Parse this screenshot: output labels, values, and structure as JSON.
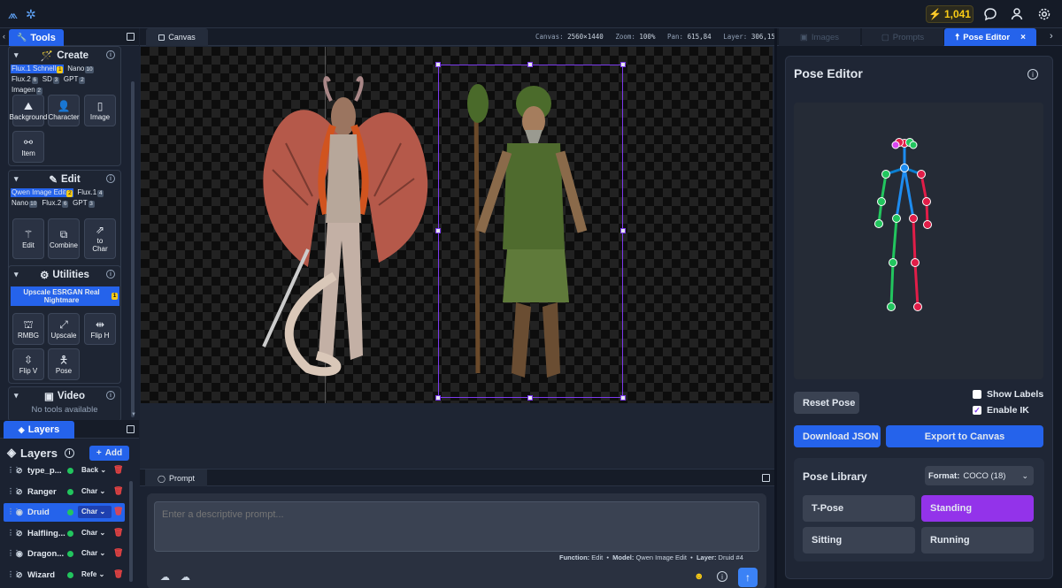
{
  "topbar": {
    "credits": "1,041"
  },
  "tools_panel": {
    "tab_label": "Tools",
    "create": {
      "title": "Create",
      "models": [
        {
          "name": "Flux.1 Schnell",
          "badge": "1",
          "selected": true,
          "yellow": true
        },
        {
          "name": "Nano",
          "badge": "10",
          "selected": false
        },
        {
          "name": "Flux.2",
          "badge": "6",
          "selected": false
        },
        {
          "name": "SD",
          "badge": "3",
          "selected": false
        },
        {
          "name": "GPT",
          "badge": "2",
          "selected": false
        },
        {
          "name": "Imagen",
          "badge": "2",
          "selected": false
        }
      ],
      "buttons": [
        "Background",
        "Character",
        "Image",
        "Item"
      ]
    },
    "edit": {
      "title": "Edit",
      "models": [
        {
          "name": "Qwen Image Edit",
          "badge": "2",
          "selected": true,
          "yellow": true
        },
        {
          "name": "Flux.1",
          "badge": "4",
          "selected": false
        },
        {
          "name": "Nano",
          "badge": "10",
          "selected": false
        },
        {
          "name": "Flux.2",
          "badge": "6",
          "selected": false
        },
        {
          "name": "GPT",
          "badge": "3",
          "selected": false
        }
      ],
      "buttons": [
        "Edit",
        "Combine",
        "to\nChar"
      ]
    },
    "utilities": {
      "title": "Utilities",
      "upscale_model": "Upscale ESRGAN Real Nightmare",
      "upscale_badge": "1",
      "buttons": [
        "RMBG",
        "Upscale",
        "Flip H",
        "Flip V",
        "Pose"
      ]
    },
    "video": {
      "title": "Video",
      "empty": "No tools available"
    }
  },
  "layers_panel": {
    "tab_label": "Layers",
    "title": "Layers",
    "add_label": "Add",
    "rows": [
      {
        "name": "type_p...",
        "type": "Back",
        "selected": false,
        "visible": false
      },
      {
        "name": "Ranger",
        "type": "Char",
        "selected": false,
        "visible": false
      },
      {
        "name": "Druid",
        "type": "Char",
        "selected": true,
        "visible": true
      },
      {
        "name": "Halfling...",
        "type": "Char",
        "selected": false,
        "visible": false
      },
      {
        "name": "Dragon...",
        "type": "Char",
        "selected": false,
        "visible": true
      },
      {
        "name": "Wizard",
        "type": "Refe",
        "selected": false,
        "visible": false
      }
    ]
  },
  "canvas_panel": {
    "tab_label": "Canvas",
    "status": {
      "canvas_label": "Canvas:",
      "canvas_value": "2560×1440",
      "zoom_label": "Zoom:",
      "zoom_value": "100%",
      "pan_label": "Pan:",
      "pan_value": "615,84",
      "layer_label": "Layer:",
      "layer_value": "306,155"
    }
  },
  "prompt_panel": {
    "tab_label": "Prompt",
    "placeholder": "Enter a descriptive prompt...",
    "function_label": "Function:",
    "function_value": "Edit",
    "model_label": "Model:",
    "model_value": "Qwen Image Edit",
    "layer_label": "Layer:",
    "layer_value": "Druid #4"
  },
  "right_tabs": {
    "images": "Images",
    "prompts": "Prompts",
    "pose_editor": "Pose Editor"
  },
  "pose_editor": {
    "title": "Pose Editor",
    "reset_label": "Reset Pose",
    "show_labels": "Show Labels",
    "show_labels_checked": false,
    "enable_ik": "Enable IK",
    "enable_ik_checked": true,
    "download_label": "Download JSON",
    "export_label": "Export to Canvas",
    "library_title": "Pose Library",
    "format_label": "Format:",
    "format_value": "COCO (18)",
    "poses": [
      "T-Pose",
      "Standing",
      "Sitting",
      "Running"
    ],
    "active_pose": "Standing"
  },
  "colors": {
    "accent": "#2563eb",
    "purple": "#9333ea",
    "selection": "#7c3aed"
  }
}
